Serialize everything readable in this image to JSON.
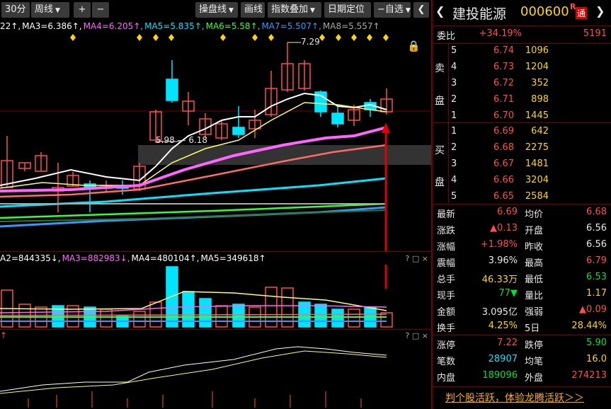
{
  "toolbar": {
    "period": "30分",
    "line_type": "周线",
    "zoom_in": "+",
    "zoom_out": "−",
    "tools": [
      "操盘线",
      "画线",
      "指数叠加",
      "日期定位",
      "自选"
    ],
    "nav": "❮"
  },
  "ma_legend": [
    {
      "text": "22↑,",
      "color": "#ffffff"
    },
    {
      "text": "MA3=6.386↑,",
      "color": "#ffffff"
    },
    {
      "text": "MA4=6.205↑,",
      "color": "#ff66ff"
    },
    {
      "text": "MA5=5.835↑,",
      "color": "#00e5ff"
    },
    {
      "text": "MA6=5.58↑,",
      "color": "#33ff33"
    },
    {
      "text": "MA7=5.507↑,",
      "color": "#3399ff"
    },
    {
      "text": "MA8=5.557↑",
      "color": "#aaaaaa"
    }
  ],
  "price_annotations": {
    "high": "7.29",
    "low_pair": "5.98 — 6.18"
  },
  "volume_legend": [
    {
      "text": "A2=844335↓,",
      "color": "#ffffff"
    },
    {
      "text": "MA3=882983↓,",
      "color": "#ff66ff"
    },
    {
      "text": "MA4=480104↑,",
      "color": "#ffffff"
    },
    {
      "text": "MA5=349618↑",
      "color": "#ffffff"
    }
  ],
  "pane_controls": "? □ ×",
  "indicator_legend": "↑",
  "stock": {
    "name": "建投能源",
    "code": "000600",
    "badge_r": "R",
    "badge_tong": "通"
  },
  "weibi": {
    "label": "委比",
    "value": "+34.19%",
    "diff": "5191"
  },
  "sell_label": [
    "卖",
    "盘"
  ],
  "buy_label": [
    "买",
    "盘"
  ],
  "sell_orders": [
    {
      "level": "5",
      "price": "6.74",
      "volume": "1096"
    },
    {
      "level": "4",
      "price": "6.73",
      "volume": "1204"
    },
    {
      "level": "3",
      "price": "6.72",
      "volume": "352"
    },
    {
      "level": "2",
      "price": "6.71",
      "volume": "898"
    },
    {
      "level": "1",
      "price": "6.70",
      "volume": "1445"
    }
  ],
  "buy_orders": [
    {
      "level": "1",
      "price": "6.69",
      "volume": "642"
    },
    {
      "level": "2",
      "price": "6.68",
      "volume": "2275"
    },
    {
      "level": "3",
      "price": "6.67",
      "volume": "1481"
    },
    {
      "level": "4",
      "price": "6.66",
      "volume": "3204"
    },
    {
      "level": "5",
      "price": "6.65",
      "volume": "2584"
    }
  ],
  "quote_rows": [
    {
      "l1": "最新",
      "v1": "6.69",
      "c1": "#ff4d4d",
      "l2": "均价",
      "v2": "6.68",
      "c2": "#ff4d4d"
    },
    {
      "l1": "涨跌",
      "v1": "▲0.13",
      "c1": "#ff4d4d",
      "l2": "开盘",
      "v2": "6.56",
      "c2": "#e8e8e8"
    },
    {
      "l1": "涨幅",
      "v1": "+1.98%",
      "c1": "#ff4d4d",
      "l2": "昨收",
      "v2": "6.56",
      "c2": "#e8e8e8"
    },
    {
      "l1": "震幅",
      "v1": "3.96%",
      "c1": "#e8e8e8",
      "l2": "最高",
      "v2": "6.79",
      "c2": "#ff4d4d"
    },
    {
      "l1": "总手",
      "v1": "46.33万",
      "c1": "#ffd700",
      "l2": "最低",
      "v2": "6.53",
      "c2": "#00e03a"
    },
    {
      "l1": "现手",
      "v1": "77▼",
      "c1": "#00e03a",
      "l2": "量比",
      "v2": "1.17",
      "c2": "#ffd700"
    },
    {
      "l1": "金额",
      "v1": "3.095亿",
      "c1": "#e8e8e8",
      "l2": "强弱",
      "v2": "▲0.09",
      "c2": "#ff4d4d"
    },
    {
      "l1": "换手",
      "v1": "4.25%",
      "c1": "#ffd700",
      "l2": "5日",
      "v2": "28.44%",
      "c2": "#ffd700"
    }
  ],
  "limit_rows": [
    {
      "l1": "涨停",
      "v1": "7.22",
      "c1": "#ff4d4d",
      "l2": "跌停",
      "v2": "5.90",
      "c2": "#00e03a"
    },
    {
      "l1": "笔数",
      "v1": "28907",
      "c1": "#00e5ff",
      "l2": "均笔",
      "v2": "16.0",
      "c2": "#ffd700"
    },
    {
      "l1": "内盘",
      "v1": "189096",
      "c1": "#00e03a",
      "l2": "外盘",
      "v2": "274213",
      "c2": "#ff4d4d"
    }
  ],
  "promo": "判个股活跃，体验龙腾活跃＞＞",
  "colors": {
    "up": "#ff4d4d",
    "down": "#00e5ff",
    "frame": "#7a0000",
    "promo": "#ffb000"
  }
}
